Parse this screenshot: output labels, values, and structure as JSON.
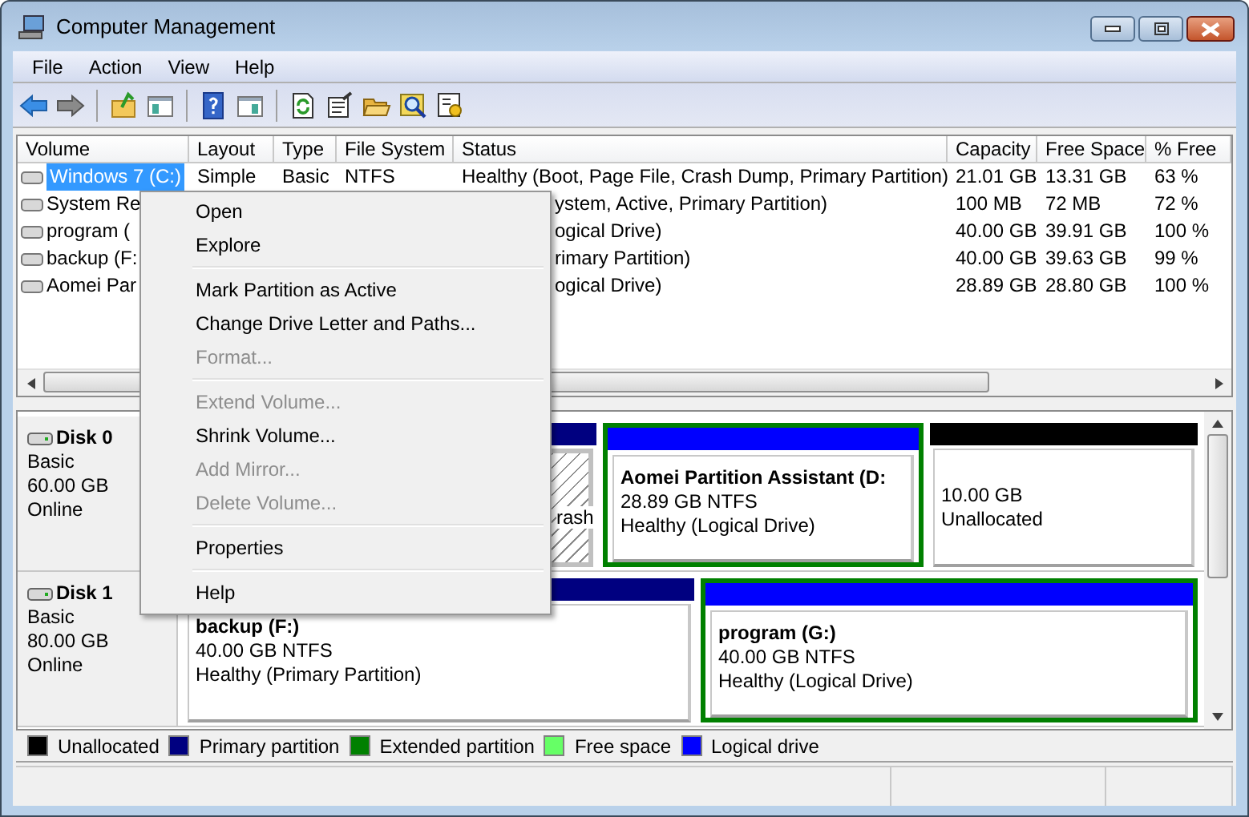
{
  "window": {
    "title": "Computer Management"
  },
  "menu_bar": [
    "File",
    "Action",
    "View",
    "Help"
  ],
  "toolbar": [
    {
      "kind": "back"
    },
    {
      "kind": "forward"
    },
    {
      "kind": "sep"
    },
    {
      "kind": "up"
    },
    {
      "kind": "tree"
    },
    {
      "kind": "sep"
    },
    {
      "kind": "help"
    },
    {
      "kind": "pane"
    },
    {
      "kind": "sep"
    },
    {
      "kind": "refresh"
    },
    {
      "kind": "properties"
    },
    {
      "kind": "folder"
    },
    {
      "kind": "search"
    },
    {
      "kind": "settings"
    }
  ],
  "volume_table": {
    "columns": [
      "Volume",
      "Layout",
      "Type",
      "File System",
      "Status",
      "Capacity",
      "Free Space",
      "% Free"
    ],
    "rows": [
      {
        "volume": "Windows 7 (C:)",
        "layout": "Simple",
        "type": "Basic",
        "file_system": "NTFS",
        "status": "Healthy (Boot, Page File, Crash Dump, Primary Partition)",
        "capacity": "21.01 GB",
        "free_space": "13.31 GB",
        "percent_free": "63 %",
        "selected": true
      },
      {
        "volume": "System Re",
        "status": "ystem, Active, Primary Partition)",
        "capacity": "100 MB",
        "free_space": "72 MB",
        "percent_free": "72 %",
        "selected": false
      },
      {
        "volume": "program (",
        "status": "ogical Drive)",
        "capacity": "40.00 GB",
        "free_space": "39.91 GB",
        "percent_free": "100 %",
        "selected": false
      },
      {
        "volume": "backup (F:",
        "status": "rimary Partition)",
        "capacity": "40.00 GB",
        "free_space": "39.63 GB",
        "percent_free": "99 %",
        "selected": false
      },
      {
        "volume": "Aomei Par",
        "status": "ogical Drive)",
        "capacity": "28.89 GB",
        "free_space": "28.80 GB",
        "percent_free": "100 %",
        "selected": false
      }
    ]
  },
  "disks": [
    {
      "name": "Disk 0",
      "type": "Basic",
      "size": "60.00 GB",
      "state": "Online",
      "partitions": [
        {
          "kind": "primary",
          "status": "rash",
          "selected": true,
          "in_extended": false
        },
        {
          "kind": "logical",
          "title": "Aomei Partition Assistant  (D:",
          "detail": "28.89 GB NTFS",
          "status": "Healthy (Logical Drive)",
          "selected": false,
          "in_extended": true
        },
        {
          "kind": "unallocated",
          "detail": "10.00 GB",
          "status": "Unallocated",
          "selected": false,
          "in_extended": false
        }
      ]
    },
    {
      "name": "Disk 1",
      "type": "Basic",
      "size": "80.00 GB",
      "state": "Online",
      "partitions": [
        {
          "kind": "primary",
          "title": "backup  (F:)",
          "detail": "40.00 GB NTFS",
          "status": "Healthy (Primary Partition)",
          "selected": false,
          "in_extended": false
        },
        {
          "kind": "logical",
          "title": "program  (G:)",
          "detail": "40.00 GB NTFS",
          "status": "Healthy (Logical Drive)",
          "selected": false,
          "in_extended": true
        }
      ]
    }
  ],
  "legend": [
    {
      "label": "Unallocated",
      "color": "#000000"
    },
    {
      "label": "Primary partition",
      "color": "#000080"
    },
    {
      "label": "Extended partition",
      "color": "#008000"
    },
    {
      "label": "Free space",
      "color": "#66ff66"
    },
    {
      "label": "Logical drive",
      "color": "#0000ff"
    }
  ],
  "context_menu": [
    {
      "kind": "item",
      "label": "Open",
      "disabled": false
    },
    {
      "kind": "item",
      "label": "Explore",
      "disabled": false
    },
    {
      "kind": "separator"
    },
    {
      "kind": "item",
      "label": "Mark Partition as Active",
      "disabled": false
    },
    {
      "kind": "item",
      "label": "Change Drive Letter and Paths...",
      "disabled": false
    },
    {
      "kind": "item",
      "label": "Format...",
      "disabled": true
    },
    {
      "kind": "separator"
    },
    {
      "kind": "item",
      "label": "Extend Volume...",
      "disabled": true
    },
    {
      "kind": "item",
      "label": "Shrink Volume...",
      "disabled": false
    },
    {
      "kind": "item",
      "label": "Add Mirror...",
      "disabled": true
    },
    {
      "kind": "item",
      "label": "Delete Volume...",
      "disabled": true
    },
    {
      "kind": "separator"
    },
    {
      "kind": "item",
      "label": "Properties",
      "disabled": false
    },
    {
      "kind": "separator"
    },
    {
      "kind": "item",
      "label": "Help",
      "disabled": false
    }
  ]
}
